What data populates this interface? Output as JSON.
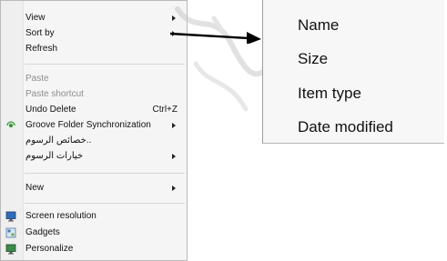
{
  "context_menu": {
    "items": [
      {
        "label": "View"
      },
      {
        "label": "Sort by"
      },
      {
        "label": "Refresh"
      },
      {
        "label": "Paste"
      },
      {
        "label": "Paste shortcut"
      },
      {
        "label": "Undo Delete",
        "shortcut": "Ctrl+Z"
      },
      {
        "label": "Groove Folder Synchronization"
      },
      {
        "label": "..خصائص الرسوم"
      },
      {
        "label": "خيارات الرسوم"
      },
      {
        "label": "New"
      },
      {
        "label": "Screen resolution"
      },
      {
        "label": "Gadgets"
      },
      {
        "label": "Personalize"
      }
    ]
  },
  "sort_submenu": {
    "items": [
      {
        "label": "Name"
      },
      {
        "label": "Size"
      },
      {
        "label": "Item type"
      },
      {
        "label": "Date modified"
      }
    ]
  },
  "icons": {
    "groove": "groove-sync-icon",
    "screen_resolution": "screen-resolution-icon",
    "gadgets": "gadgets-icon",
    "personalize": "personalize-icon"
  },
  "colors": {
    "menu_bg": "#f5f5f5",
    "disabled_text": "#8e8e8e",
    "arrow": "#000000"
  }
}
